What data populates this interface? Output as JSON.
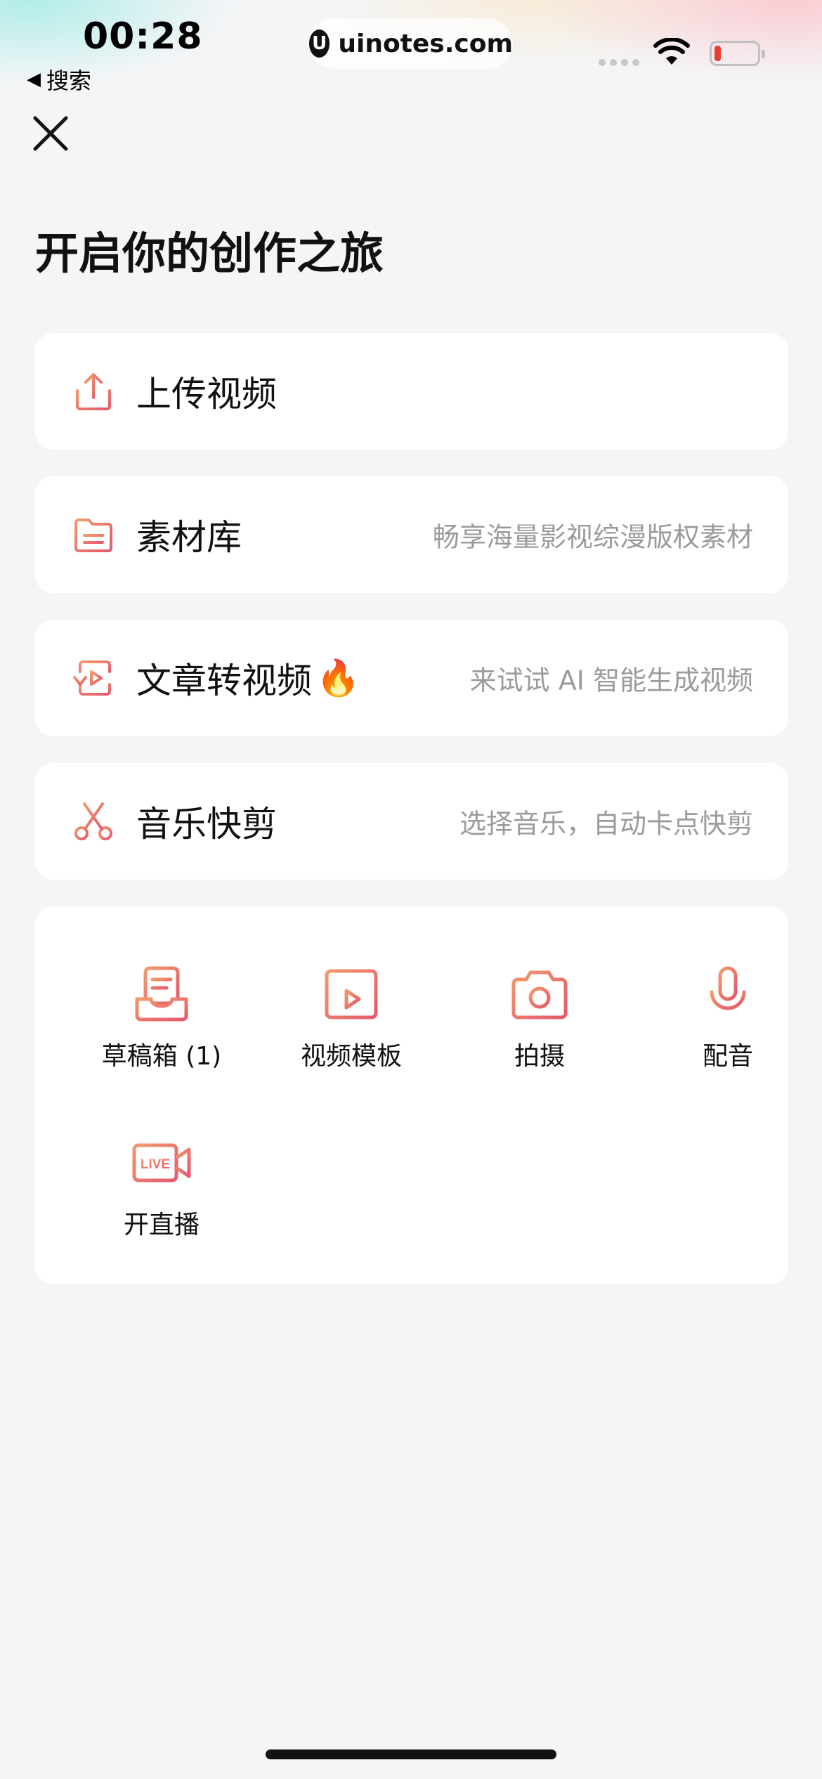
{
  "status_bar": {
    "time": "00:28",
    "back_label": "搜索",
    "url": "uinotes.com",
    "url_logo": "U"
  },
  "title": "开启你的创作之旅",
  "menu": [
    {
      "label": "上传视频",
      "subtitle": "",
      "icon": "upload-icon"
    },
    {
      "label": "素材库",
      "subtitle": "畅享海量影视综漫版权素材",
      "icon": "library-icon"
    },
    {
      "label": "文章转视频",
      "emoji": "🔥",
      "subtitle": "来试试 AI 智能生成视频",
      "icon": "article-to-video-icon"
    },
    {
      "label": "音乐快剪",
      "subtitle": "选择音乐，自动卡点快剪",
      "icon": "scissors-icon"
    }
  ],
  "tools": [
    {
      "label": "草稿箱 (1)",
      "icon": "drafts-icon"
    },
    {
      "label": "视频模板",
      "icon": "video-template-icon"
    },
    {
      "label": "拍摄",
      "icon": "camera-icon"
    },
    {
      "label": "配音",
      "icon": "microphone-icon"
    },
    {
      "label": "开直播",
      "icon": "live-icon",
      "icon_text": "LIVE"
    }
  ],
  "accent_gradient": [
    "#f19a6c",
    "#e5586d"
  ]
}
